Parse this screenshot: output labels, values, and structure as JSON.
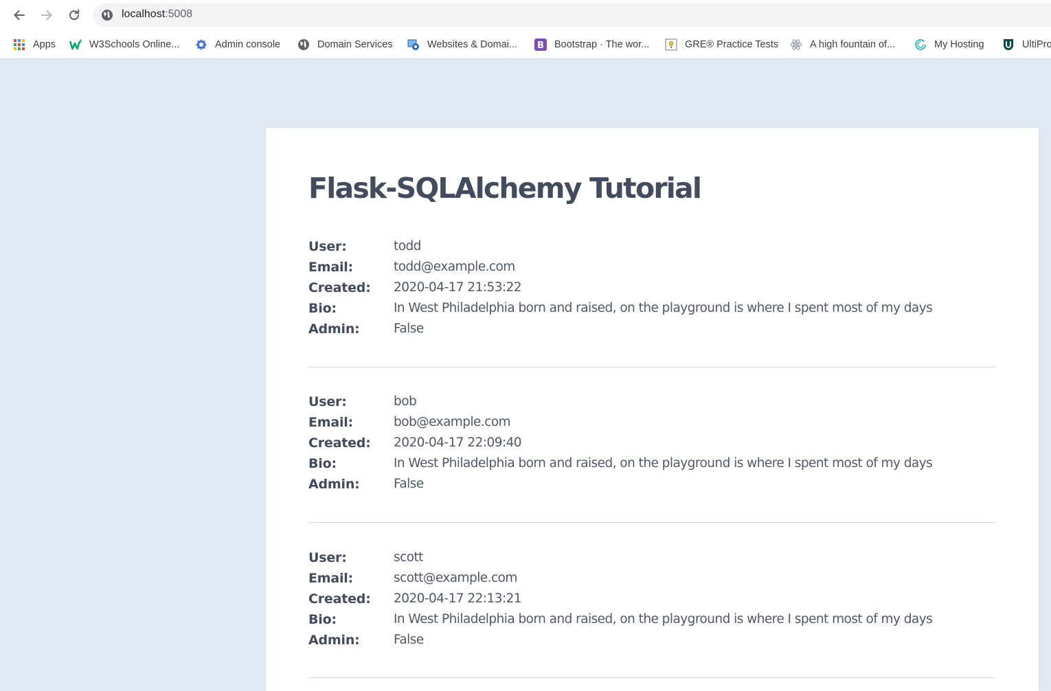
{
  "browser": {
    "url_host": "localhost",
    "url_port": ":5008"
  },
  "bookmarks": [
    {
      "label": "Apps",
      "icon": "apps-grid-icon"
    },
    {
      "label": "W3Schools Online...",
      "icon": "w3schools-icon"
    },
    {
      "label": "Admin console",
      "icon": "admin-console-icon"
    },
    {
      "label": "Domain Services",
      "icon": "globe-icon"
    },
    {
      "label": "Websites & Domai...",
      "icon": "websites-icon"
    },
    {
      "label": "Bootstrap · The wor...",
      "icon": "bootstrap-icon"
    },
    {
      "label": "GRE® Practice Tests",
      "icon": "gre-icon"
    },
    {
      "label": "A high fountain of...",
      "icon": "atom-icon"
    },
    {
      "label": "My Hosting",
      "icon": "hosting-icon"
    },
    {
      "label": "UltiPro",
      "icon": "ultipro-icon"
    }
  ],
  "page": {
    "title": "Flask-SQLAlchemy Tutorial",
    "labels": {
      "user": "User:",
      "email": "Email:",
      "created": "Created:",
      "bio": "Bio:",
      "admin": "Admin:"
    },
    "users": [
      {
        "user": "todd",
        "email": "todd@example.com",
        "created": "2020-04-17 21:53:22",
        "bio": "In West Philadelphia born and raised, on the playground is where I spent most of my days",
        "admin": "False"
      },
      {
        "user": "bob",
        "email": "bob@example.com",
        "created": "2020-04-17 22:09:40",
        "bio": "In West Philadelphia born and raised, on the playground is where I spent most of my days",
        "admin": "False"
      },
      {
        "user": "scott",
        "email": "scott@example.com",
        "created": "2020-04-17 22:13:21",
        "bio": "In West Philadelphia born and raised, on the playground is where I spent most of my days",
        "admin": "False"
      }
    ]
  },
  "colors": {
    "page_background": "#e2e8f2",
    "heading": "#434b5e",
    "text": "#4f5869"
  }
}
